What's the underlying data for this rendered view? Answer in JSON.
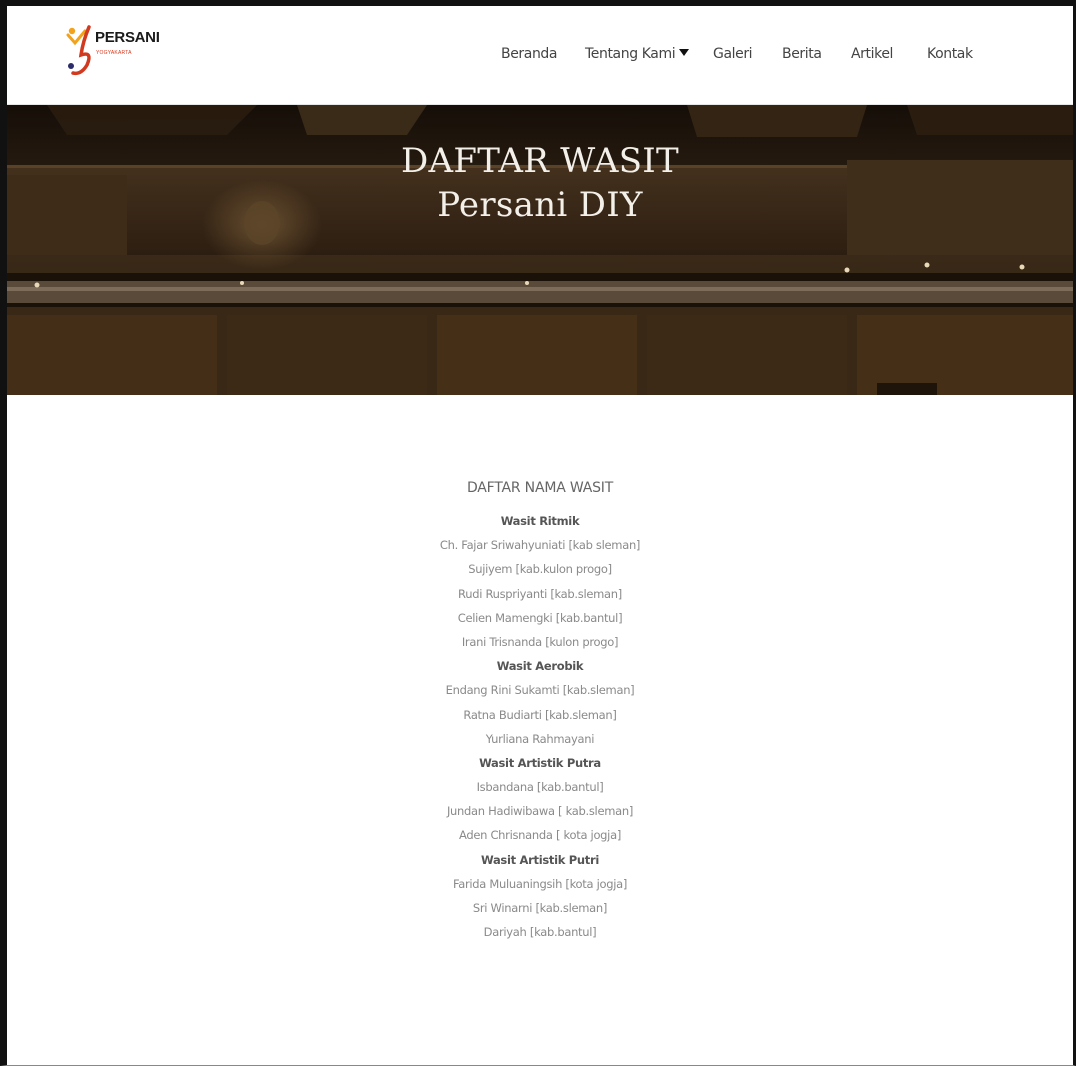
{
  "brand": {
    "name": "PERSANI",
    "subtitle": "YOGYAKARTA",
    "colors": {
      "accent": "#d23a1f",
      "secondary": "#f2a21b"
    }
  },
  "nav": {
    "items": [
      "Beranda",
      "Tentang Kami",
      "Galeri",
      "Berita",
      "Artikel",
      "Kontak"
    ],
    "dropdown_item_index": 1
  },
  "hero": {
    "title_line1": "DAFTAR WASIT",
    "title_line2": "Persani DIY"
  },
  "content": {
    "heading": "DAFTAR NAMA WASIT",
    "sections": [
      {
        "title": "Wasit Ritmik",
        "names": [
          "Ch. Fajar Sriwahyuniati [kab sleman]",
          "Sujiyem [kab.kulon progo]",
          "Rudi Ruspriyanti [kab.sleman]",
          "Celien Mamengki [kab.bantul]",
          "Irani Trisnanda [kulon progo]"
        ]
      },
      {
        "title": "Wasit Aerobik",
        "names": [
          "Endang Rini Sukamti [kab.sleman]",
          "Ratna Budiarti [kab.sleman]",
          "Yurliana Rahmayani"
        ]
      },
      {
        "title": "Wasit Artistik Putra",
        "names": [
          "Isbandana [kab.bantul]",
          "Jundan Hadiwibawa [ kab.sleman]",
          "Aden Chrisnanda [ kota jogja]"
        ]
      },
      {
        "title": "Wasit Artistik Putri",
        "names": [
          "Farida Muluaningsih [kota jogja]",
          "Sri Winarni [kab.sleman]",
          "Dariyah [kab.bantul]"
        ]
      }
    ]
  }
}
